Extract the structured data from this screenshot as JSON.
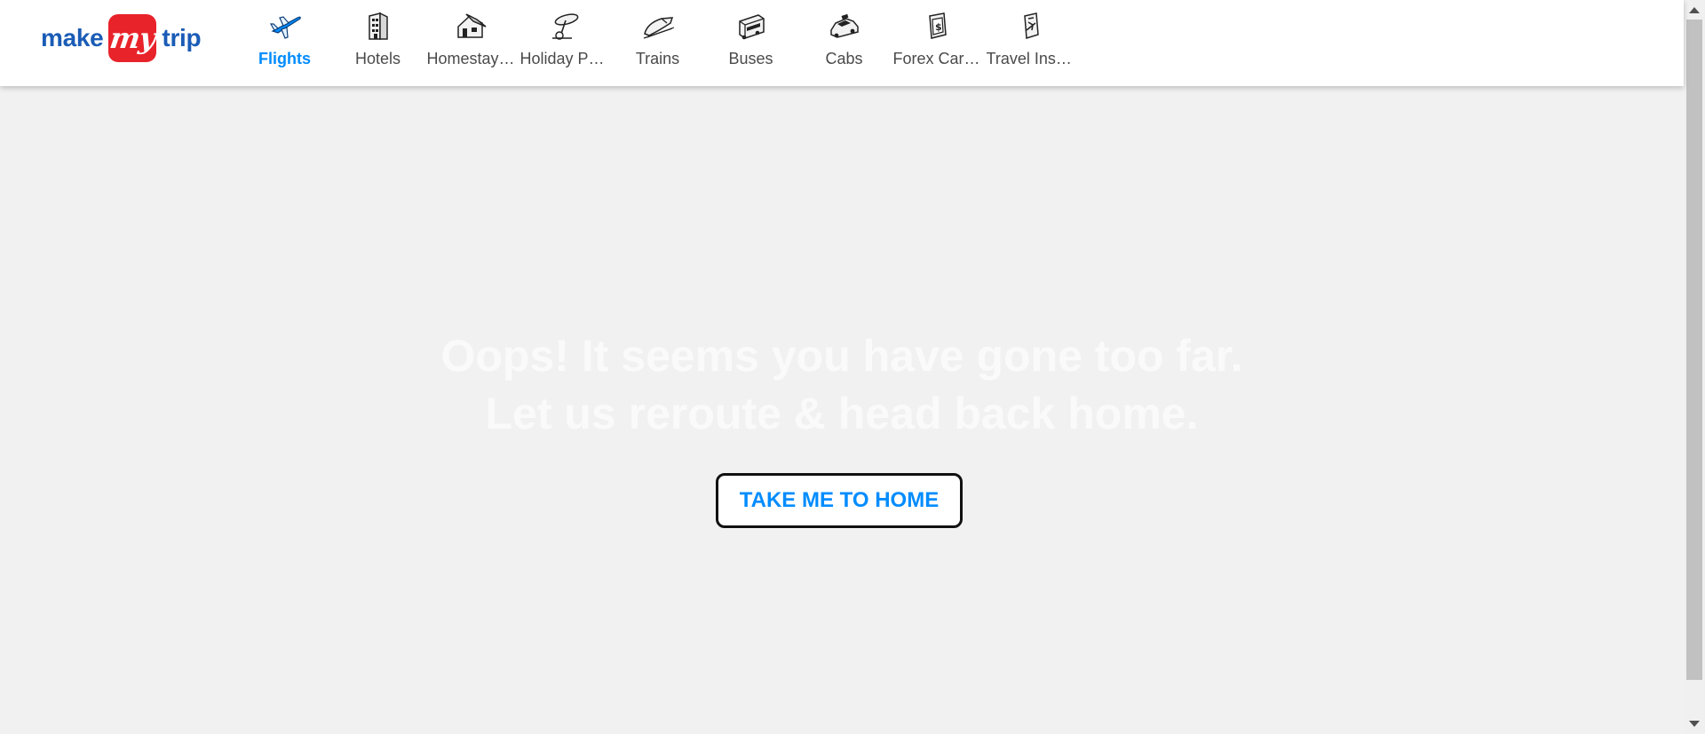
{
  "header": {
    "logo": {
      "make": "make",
      "my": "my",
      "trip": "trip"
    },
    "nav": [
      {
        "label": "Flights",
        "icon": "flights-icon",
        "active": true
      },
      {
        "label": "Hotels",
        "icon": "hotels-icon"
      },
      {
        "label": "Homestays & Villas",
        "icon": "homestays-icon"
      },
      {
        "label": "Holiday Packages",
        "icon": "holiday-packages-icon"
      },
      {
        "label": "Trains",
        "icon": "trains-icon"
      },
      {
        "label": "Buses",
        "icon": "buses-icon"
      },
      {
        "label": "Cabs",
        "icon": "cabs-icon"
      },
      {
        "label": "Forex Card & Currency",
        "icon": "forex-icon"
      },
      {
        "label": "Travel Insurance",
        "icon": "travel-insurance-icon"
      }
    ]
  },
  "main": {
    "headline_line1": "Oops! It seems you have gone too far.",
    "headline_line2": "Let us reroute & head back home.",
    "button_label": "TAKE ME TO HOME"
  },
  "colors": {
    "brand_blue": "#008cff",
    "logo_blue": "#1a5cb6",
    "logo_red": "#e8232a",
    "background": "#f1f1f1"
  }
}
